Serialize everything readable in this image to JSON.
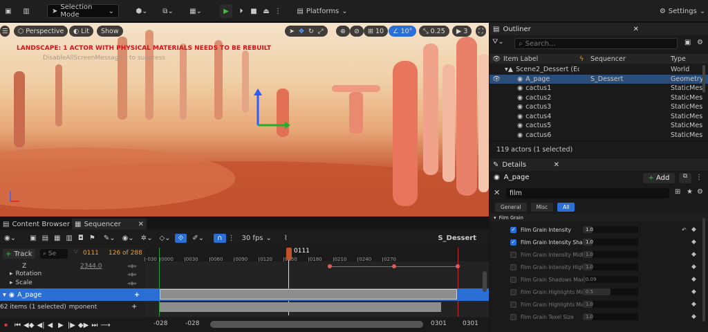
{
  "toolbar": {
    "mode": "Selection Mode",
    "platforms": "Platforms",
    "settings": "Settings"
  },
  "viewport": {
    "perspective": "Perspective",
    "lit": "Lit",
    "show": "Show",
    "grid": "10",
    "angle": "10°",
    "scale": "0.25",
    "camera_speed": "3",
    "warning": "LANDSCAPE: 1 ACTOR WITH PHYSICAL MATERIALS NEEDS TO BE REBUILT",
    "sub_message": "DisableAllScreenMessages' to suppress"
  },
  "outliner": {
    "tab": "Outliner",
    "search_placeholder": "Search...",
    "col_label": "Item Label",
    "col_sequencer": "Sequencer",
    "col_type": "Type",
    "rows": [
      {
        "label": "Scene2_Dessert (Edi",
        "seq": "",
        "type": "World"
      },
      {
        "label": "A_page",
        "seq": "S_Dessert",
        "type": "Geometry"
      },
      {
        "label": "cactus1",
        "seq": "",
        "type": "StaticMes"
      },
      {
        "label": "cactus2",
        "seq": "",
        "type": "StaticMes"
      },
      {
        "label": "cactus3",
        "seq": "",
        "type": "StaticMes"
      },
      {
        "label": "cactus4",
        "seq": "",
        "type": "StaticMes"
      },
      {
        "label": "cactus5",
        "seq": "",
        "type": "StaticMes"
      },
      {
        "label": "cactus6",
        "seq": "",
        "type": "StaticMes"
      }
    ],
    "status": "119 actors (1 selected)"
  },
  "details": {
    "tab": "Details",
    "actor": "A_page",
    "add": "Add",
    "filter": "film",
    "tabs": [
      "General",
      "Misc",
      "All"
    ],
    "section": "Film Grain",
    "rows": [
      {
        "label": "Film Grain Intensity",
        "value": "1.0",
        "checked": true,
        "fill": 0.18
      },
      {
        "label": "Film Grain Intensity Sha",
        "value": "1.0",
        "checked": true,
        "fill": 0.18
      },
      {
        "label": "Film Grain Intensity Midt",
        "value": "1.0",
        "checked": false,
        "fill": 0.18
      },
      {
        "label": "Film Grain Intensity High",
        "value": "1.0",
        "checked": false,
        "fill": 0.18
      },
      {
        "label": "Film Grain Shadows Max",
        "value": "0.09",
        "checked": false,
        "fill": 0.05
      },
      {
        "label": "Film Grain Highlights Min",
        "value": "0.5",
        "checked": false,
        "fill": 0.5
      },
      {
        "label": "Film Grain Highlights Max",
        "value": "1.0",
        "checked": false,
        "fill": 0.18
      },
      {
        "label": "Film Grain Texel Size",
        "value": "1.0",
        "checked": false,
        "fill": 0.18
      }
    ]
  },
  "sequencer": {
    "tab_content": "Content Browser",
    "tab_seq": "Sequencer",
    "fps": "30 fps",
    "name": "S_Dessert",
    "track": "Track",
    "search": "Se",
    "frame": "0111",
    "count": "126 of 288",
    "current": "0111",
    "z_label": "Z",
    "z_value": "2344.0",
    "rotation": "Rotation",
    "scale": "Scale",
    "a_page": "A_page",
    "component": "Component",
    "items": "62 items (1 selected)",
    "ticks": [
      "-030",
      "0000",
      "0030",
      "0060",
      "0090",
      "0120",
      "0150",
      "0180",
      "0210",
      "0240",
      "0270"
    ],
    "range_start": "-028",
    "range_start2": "-028",
    "range_end": "0301",
    "range_end2": "0301"
  }
}
